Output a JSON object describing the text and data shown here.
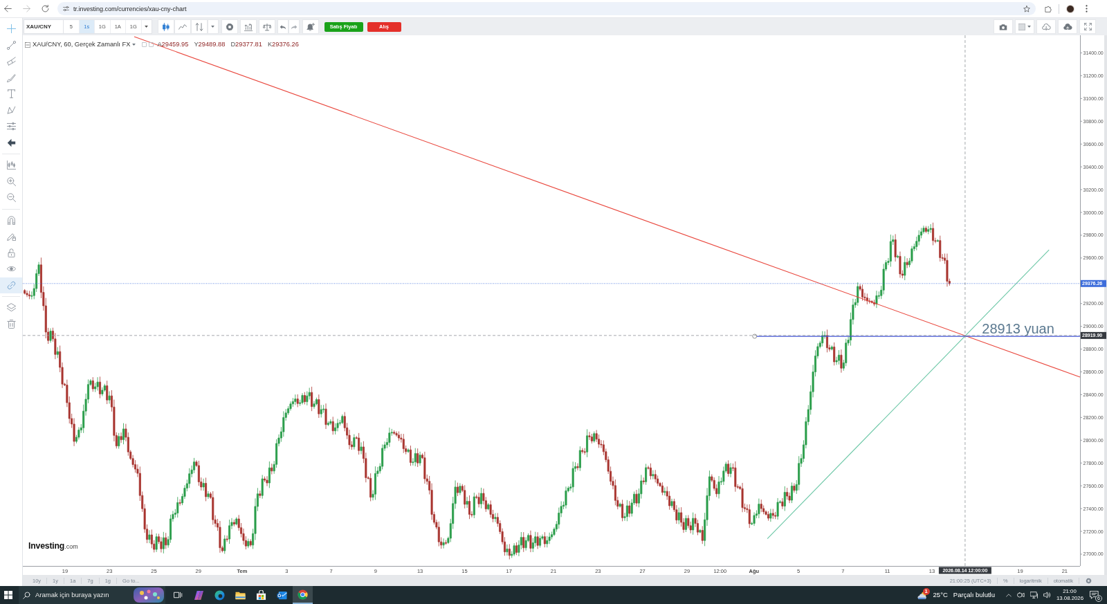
{
  "browser": {
    "address": "tr.investing.com/currencies/xau-cny-chart"
  },
  "drawing_tools": [
    {
      "selected": true,
      "on": false
    },
    {
      "selected": false,
      "on": false
    },
    {
      "selected": false,
      "on": false
    },
    {
      "selected": false,
      "on": false
    },
    {
      "selected": false,
      "on": false
    },
    {
      "selected": false,
      "on": false
    },
    {
      "selected": false,
      "on": false
    },
    {
      "selected": false,
      "on": false
    },
    {
      "selected": false,
      "on": false
    },
    {
      "selected": false,
      "on": false
    },
    {
      "selected": false,
      "on": false
    },
    {
      "selected": false,
      "on": false
    },
    {
      "selected": false,
      "on": false
    },
    {
      "selected": false,
      "on": false
    },
    {
      "selected": false,
      "on": false
    },
    {
      "selected": false,
      "on": true
    },
    {
      "selected": false,
      "on": false
    },
    {
      "selected": false,
      "on": false
    }
  ],
  "toolbar": {
    "symbol": "XAU/CNY",
    "intervals": [
      {
        "label": "5",
        "selected": false
      },
      {
        "label": "1s",
        "selected": true
      },
      {
        "label": "1G",
        "selected": false
      },
      {
        "label": "1A",
        "selected": false
      },
      {
        "label": "1G",
        "selected": false
      }
    ],
    "chart_types": [
      {
        "selected": true
      },
      {
        "selected": false
      }
    ],
    "trade_buttons": [
      {
        "label": "Satış Fiyatı",
        "kind": "sell"
      },
      {
        "label": "Alış",
        "kind": "buy"
      }
    ]
  },
  "legend": {
    "title": "XAU/CNY, 60, Gerçek Zamanlı FX",
    "values": [
      {
        "label": "A",
        "value": "29459.95"
      },
      {
        "label": "Y",
        "value": "29489.88"
      },
      {
        "label": "D",
        "value": "29377.81"
      },
      {
        "label": "K",
        "value": "29376.26"
      }
    ]
  },
  "chart": {
    "price_labels": [
      "31400.00",
      "31200.00",
      "31000.00",
      "30800.00",
      "30600.00",
      "30400.00",
      "30200.00",
      "30000.00",
      "29800.00",
      "29600.00",
      "29200.00",
      "29000.00",
      "28800.00",
      "28600.00",
      "28400.00",
      "28200.00",
      "28000.00",
      "27800.00",
      "27600.00",
      "27400.00",
      "27200.00",
      "27000.00"
    ],
    "time_labels": [
      {
        "text": "19",
        "kind": "day"
      },
      {
        "text": "23",
        "kind": "day"
      },
      {
        "text": "25",
        "kind": "day"
      },
      {
        "text": "29",
        "kind": "day"
      },
      {
        "text": "Tem",
        "kind": "month"
      },
      {
        "text": "3",
        "kind": "day"
      },
      {
        "text": "7",
        "kind": "day"
      },
      {
        "text": "9",
        "kind": "day"
      },
      {
        "text": "13",
        "kind": "day"
      },
      {
        "text": "15",
        "kind": "day"
      },
      {
        "text": "17",
        "kind": "day"
      },
      {
        "text": "21",
        "kind": "day"
      },
      {
        "text": "23",
        "kind": "day"
      },
      {
        "text": "27",
        "kind": "day"
      },
      {
        "text": "29",
        "kind": "day"
      },
      {
        "text": "12:00",
        "kind": "day"
      },
      {
        "text": "Ağu",
        "kind": "month"
      },
      {
        "text": "5",
        "kind": "day"
      },
      {
        "text": "7",
        "kind": "day"
      },
      {
        "text": "11",
        "kind": "day"
      },
      {
        "text": "13",
        "kind": "day"
      },
      {
        "text": "19",
        "kind": "day"
      },
      {
        "text": "21",
        "kind": "day"
      }
    ],
    "last_price": "29376.26",
    "crosshair_price": "28919.90",
    "crosshair_time": "2026.08.14 12:00:00",
    "note": "28913 yuan"
  },
  "logo": "**Investing**.com",
  "bottom_bar": {
    "ranges": [
      "10y",
      "1y",
      "1a",
      "7g",
      "1g",
      "Go to..."
    ],
    "clock": "21:00:25 (UTC+3)",
    "options": [
      "%",
      "logaritmik",
      "otomatik"
    ]
  },
  "taskbar": {
    "search_placeholder": "Aramak için buraya yazın",
    "apps": [
      {
        "selected": false
      },
      {
        "selected": false
      },
      {
        "selected": false
      },
      {
        "selected": false
      },
      {
        "selected": false
      },
      {
        "selected": true
      }
    ],
    "weather": {
      "badge": "1",
      "temperature": "25°C",
      "condition": "Parçalı bulutlu"
    },
    "time": "21:00",
    "date": "13.08.2026",
    "notification_count": "6"
  }
}
